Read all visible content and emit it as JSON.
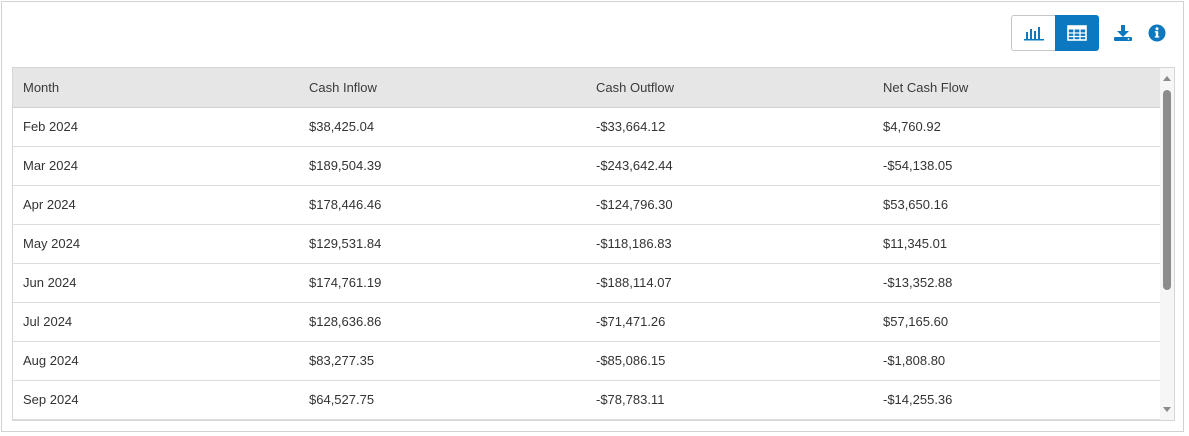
{
  "toolbar": {
    "chart_view_icon": "bar-chart-icon",
    "table_view_icon": "table-icon",
    "download_icon": "download-icon",
    "info_icon": "info-icon",
    "active_view": "table",
    "accent_color": "#0b78c0"
  },
  "table": {
    "columns": [
      "Month",
      "Cash Inflow",
      "Cash Outflow",
      "Net Cash Flow"
    ],
    "rows": [
      [
        "Feb 2024",
        "$38,425.04",
        "-$33,664.12",
        "$4,760.92"
      ],
      [
        "Mar 2024",
        "$189,504.39",
        "-$243,642.44",
        "-$54,138.05"
      ],
      [
        "Apr 2024",
        "$178,446.46",
        "-$124,796.30",
        "$53,650.16"
      ],
      [
        "May 2024",
        "$129,531.84",
        "-$118,186.83",
        "$11,345.01"
      ],
      [
        "Jun 2024",
        "$174,761.19",
        "-$188,114.07",
        "-$13,352.88"
      ],
      [
        "Jul 2024",
        "$128,636.86",
        "-$71,471.26",
        "$57,165.60"
      ],
      [
        "Aug 2024",
        "$83,277.35",
        "-$85,086.15",
        "-$1,808.80"
      ],
      [
        "Sep 2024",
        "$64,527.75",
        "-$78,783.11",
        "-$14,255.36"
      ]
    ]
  }
}
